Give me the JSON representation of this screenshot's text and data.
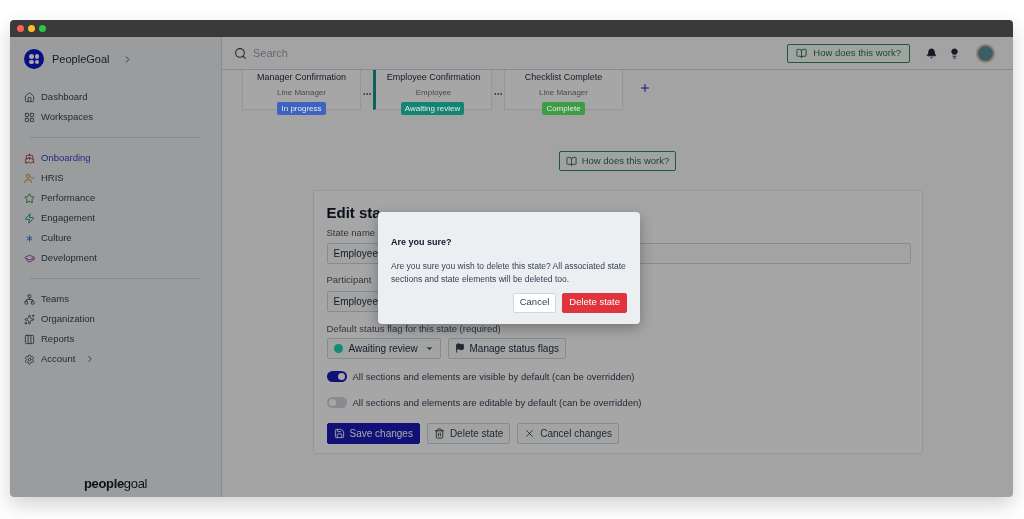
{
  "sidebar": {
    "org": "PeopleGoal",
    "groups": [
      {
        "items": [
          {
            "label": "Dashboard",
            "selected": false,
            "expandable": false
          },
          {
            "label": "Workspaces",
            "selected": false,
            "expandable": false
          }
        ]
      },
      {
        "items": [
          {
            "label": "Onboarding",
            "selected": true,
            "expandable": false
          },
          {
            "label": "HRIS",
            "selected": false,
            "expandable": false
          },
          {
            "label": "Performance",
            "selected": false,
            "expandable": false
          },
          {
            "label": "Engagement",
            "selected": false,
            "expandable": false
          },
          {
            "label": "Culture",
            "selected": false,
            "expandable": false
          },
          {
            "label": "Development",
            "selected": false,
            "expandable": false
          }
        ]
      },
      {
        "items": [
          {
            "label": "Teams",
            "selected": false,
            "expandable": false
          },
          {
            "label": "Organization",
            "selected": false,
            "expandable": false
          },
          {
            "label": "Reports",
            "selected": false,
            "expandable": false
          },
          {
            "label": "Account",
            "selected": false,
            "expandable": true
          }
        ]
      }
    ],
    "footer_logo": "**people**goal"
  },
  "topbar": {
    "search_placeholder": "Search",
    "help_button": "How does this work?"
  },
  "stages": [
    {
      "title": "Manager Confirmation",
      "role": "Line Manager",
      "status": "In progress",
      "color": "#3d63c0",
      "selected": false
    },
    {
      "title": "Employee Confirmation",
      "role": "Employee",
      "status": "Awaiting review",
      "color": "#128575",
      "selected": true
    },
    {
      "title": "Checklist Complete",
      "role": "Line Manager",
      "status": "Complete",
      "color": "#3c9d44",
      "selected": false
    }
  ],
  "help_button": "How does this work?",
  "form": {
    "title": "Edit sta",
    "fields": [
      {
        "label": "State name",
        "value": "Employee"
      },
      {
        "label": "Participant",
        "value": "Employee"
      }
    ],
    "status_label": "Default status flag for this state (required)",
    "status_select": {
      "value": "Awaiting review",
      "color": "#128a76"
    },
    "manage_button": "Manage status flags",
    "toggles": [
      {
        "label": "All sections and elements are visible by default (can be overridden)",
        "on": true
      },
      {
        "label": "All sections and elements are editable by default (can be overridden)",
        "on": false
      }
    ],
    "buttons": [
      {
        "label": "Save changes",
        "kind": "save"
      },
      {
        "label": "Delete state",
        "kind": "delete"
      },
      {
        "label": "Cancel changes",
        "kind": "cancel"
      }
    ]
  },
  "modal": {
    "title": "Are you sure?",
    "message": "Are you sure you wish to delete this state? All associated state sections and state elements will be deleted too.",
    "buttons": [
      {
        "label": "Cancel",
        "kind": "secondary"
      },
      {
        "label": "Delete state",
        "kind": "danger"
      }
    ]
  }
}
